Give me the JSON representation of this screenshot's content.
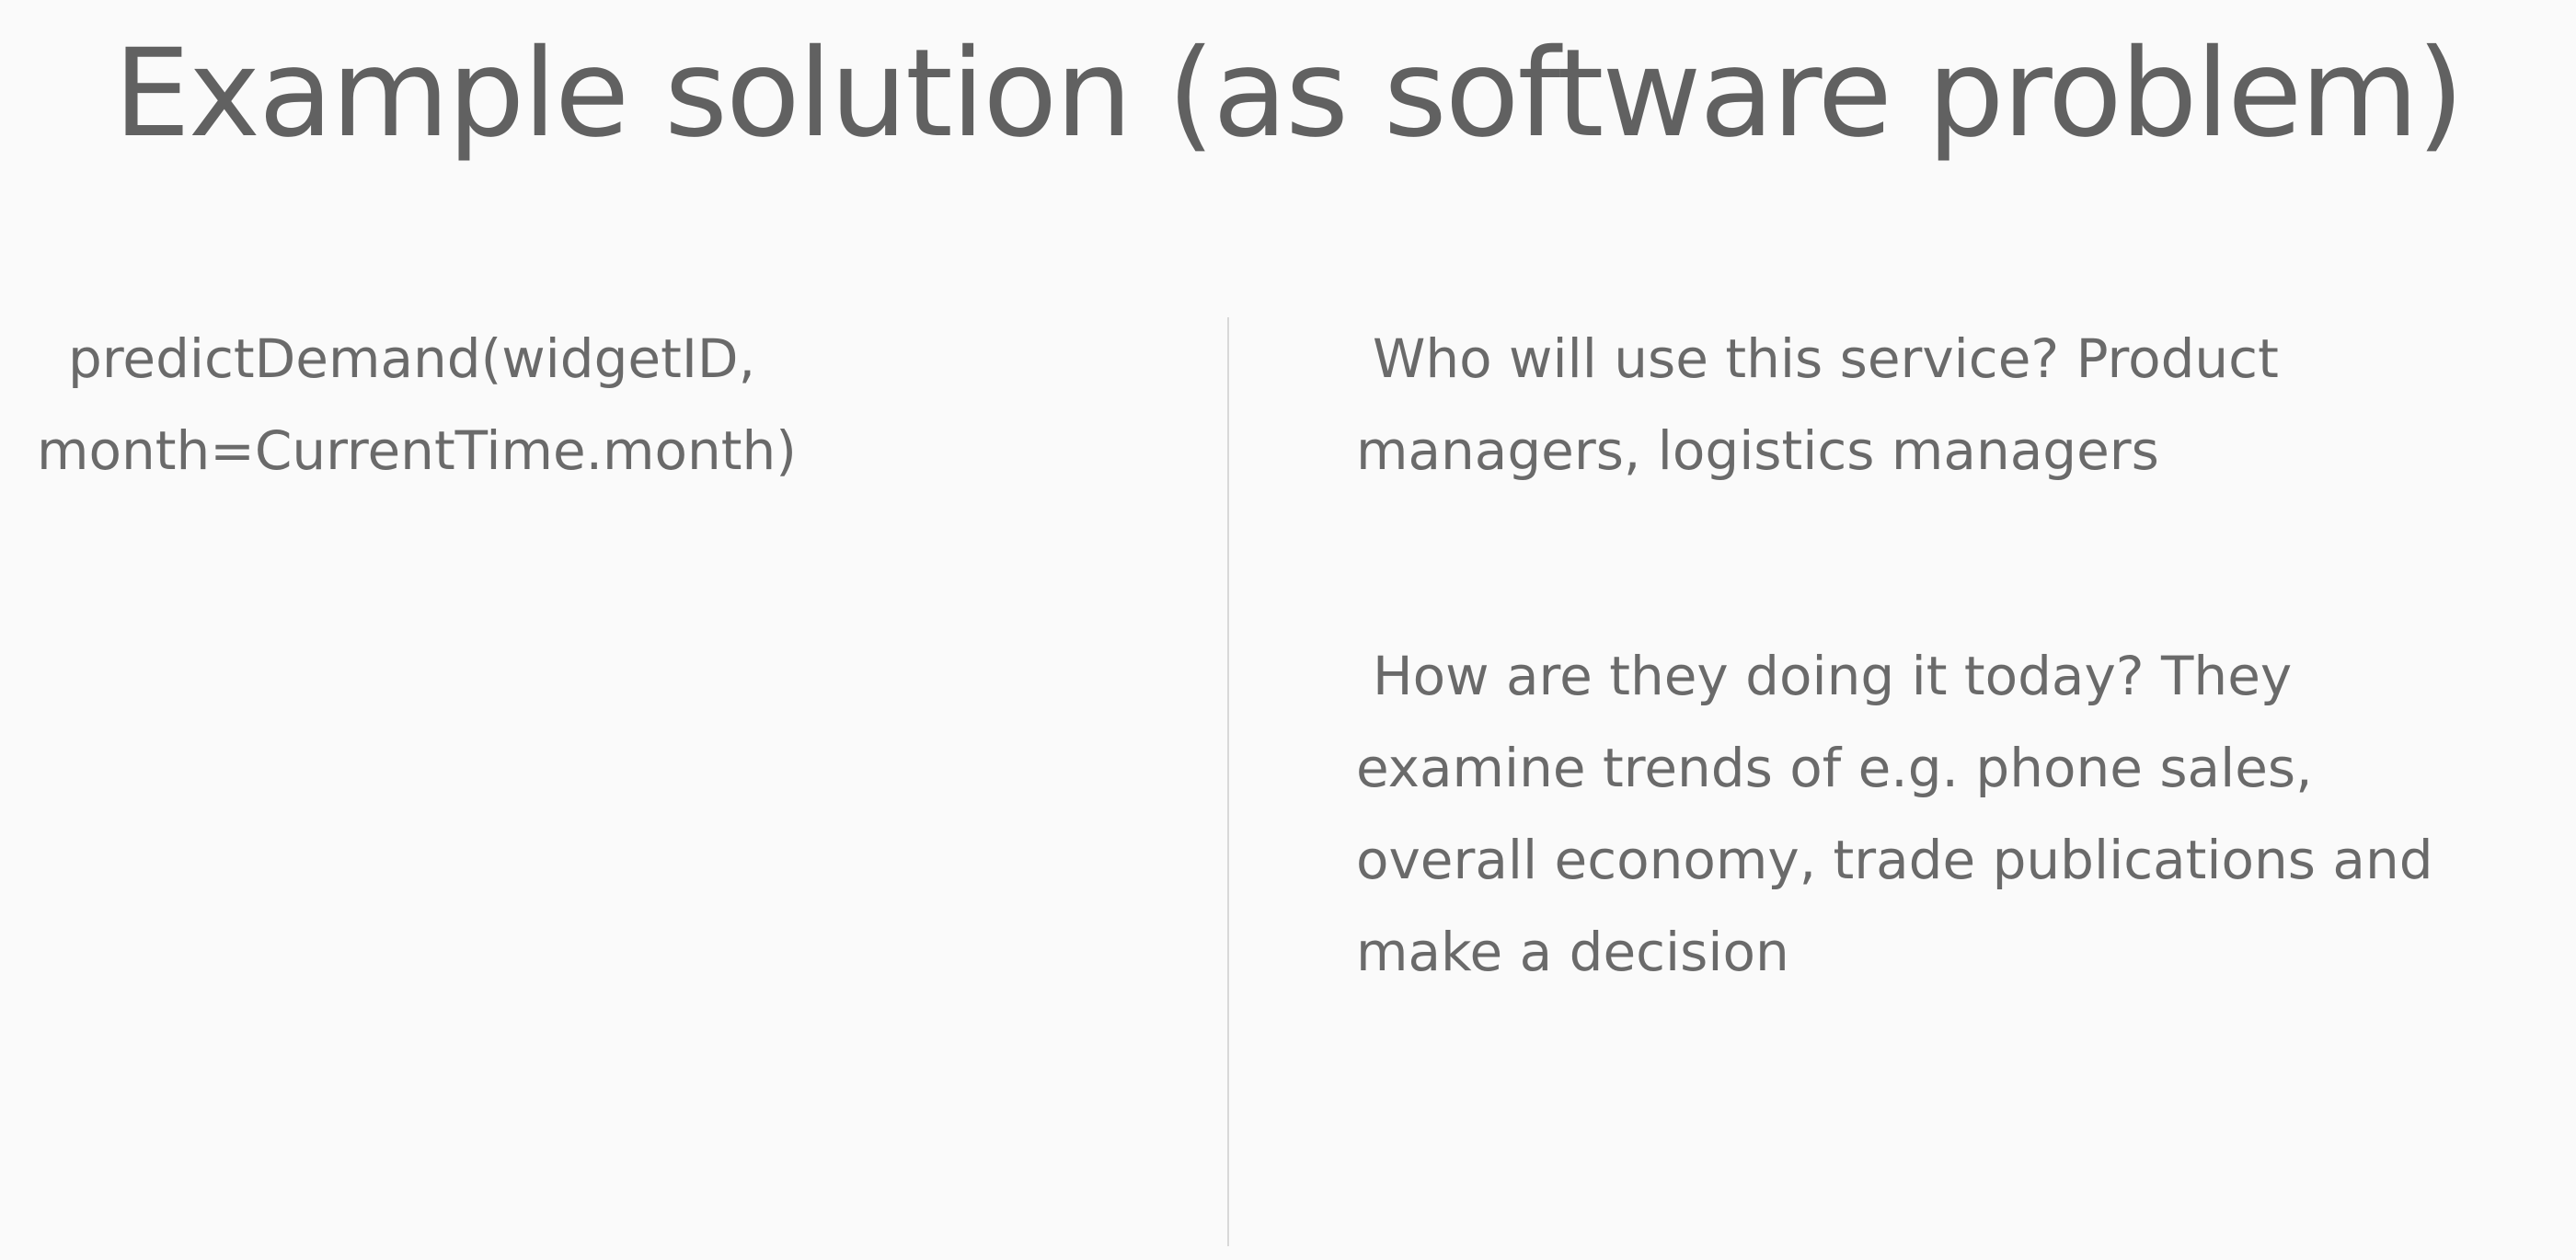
{
  "slide": {
    "title": "Example solution (as software problem)",
    "left": {
      "lines": [
        "predictDemand(widgetID,",
        "month=CurrentTime.month)"
      ]
    },
    "right": {
      "paragraph_1": {
        "lines": [
          "Who will use this service?  Product",
          "managers, logistics managers"
        ]
      },
      "paragraph_2": {
        "lines": [
          "How are they doing it today?  They",
          "examine trends of e.g. phone sales,",
          "overall economy, trade publications and",
          "make a decision"
        ]
      }
    }
  }
}
